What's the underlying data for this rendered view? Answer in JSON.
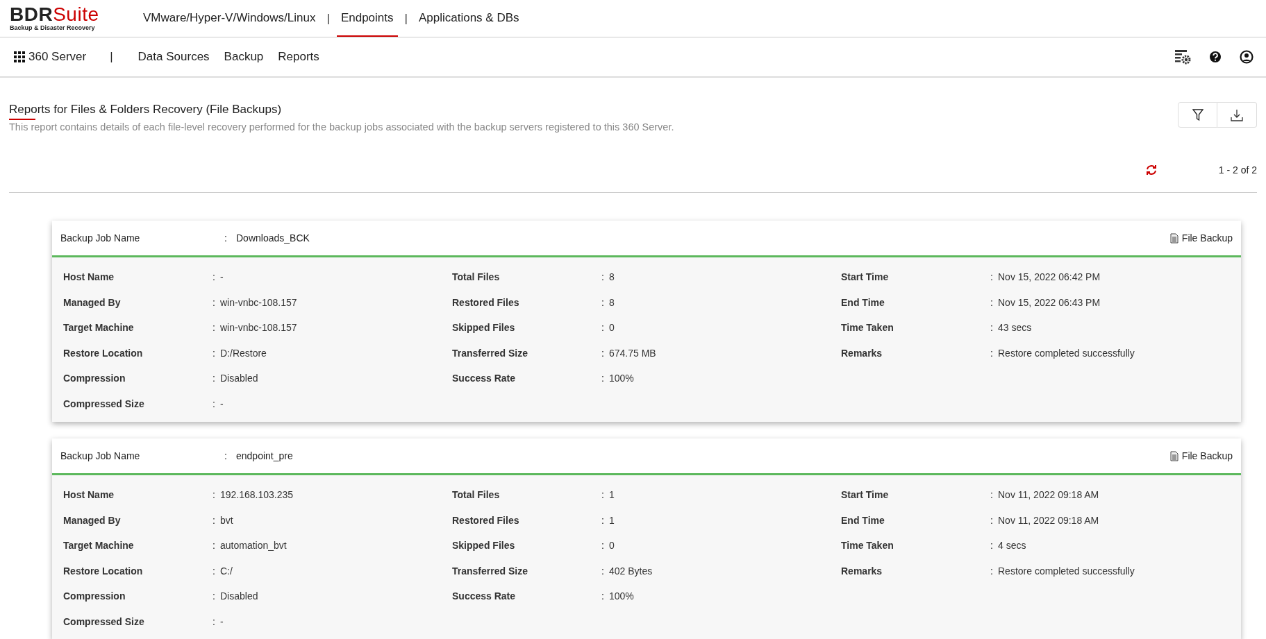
{
  "logo": {
    "brand": "BDR",
    "brand_accent": "Suite",
    "tagline": "Backup & Disaster Recovery"
  },
  "top_nav": [
    {
      "kind": "tab",
      "label": "VMware/Hyper-V/Windows/Linux",
      "selected": false
    },
    {
      "kind": "separator",
      "label": "|"
    },
    {
      "kind": "tab",
      "label": "Endpoints",
      "selected": true
    },
    {
      "kind": "separator",
      "label": "|"
    },
    {
      "kind": "tab",
      "label": "Applications & DBs",
      "selected": false
    }
  ],
  "sub_nav": {
    "server": "360 Server",
    "separator": "|",
    "items": [
      "Data Sources",
      "Backup",
      "Reports"
    ]
  },
  "page": {
    "title": "Reports for Files & Folders Recovery (File Backups)",
    "description": "This report contains details of each file-level recovery performed for the backup jobs associated with the backup servers registered to this 360 Server.",
    "pagination": "1 - 2 of 2"
  },
  "reports": [
    {
      "header": {
        "label": "Backup Job Name",
        "colon": ":",
        "value": "Downloads_BCK"
      },
      "type": "File Backup",
      "columns": [
        [
          {
            "label": "Host Name",
            "colon": ":",
            "value": "-"
          },
          {
            "label": "Managed By",
            "colon": ":",
            "value": "win-vnbc-108.157"
          },
          {
            "label": "Target Machine",
            "colon": ":",
            "value": "win-vnbc-108.157"
          },
          {
            "label": "Restore Location",
            "colon": ":",
            "value": "D:/Restore"
          },
          {
            "label": "Compression",
            "colon": ":",
            "value": "Disabled"
          },
          {
            "label": "Compressed Size",
            "colon": ":",
            "value": "-"
          }
        ],
        [
          {
            "label": "Total Files",
            "colon": ":",
            "value": "8"
          },
          {
            "label": "Restored Files",
            "colon": ":",
            "value": "8"
          },
          {
            "label": "Skipped Files",
            "colon": ":",
            "value": "0"
          },
          {
            "label": "Transferred Size",
            "colon": ":",
            "value": "674.75 MB"
          },
          {
            "label": "Success Rate",
            "colon": ":",
            "value": "100%"
          }
        ],
        [
          {
            "label": "Start Time",
            "colon": ":",
            "value": "Nov 15, 2022 06:42 PM"
          },
          {
            "label": "End Time",
            "colon": ":",
            "value": "Nov 15, 2022 06:43 PM"
          },
          {
            "label": "Time Taken",
            "colon": ":",
            "value": "43 secs"
          },
          {
            "label": "Remarks",
            "colon": ":",
            "value": "Restore completed successfully"
          }
        ]
      ]
    },
    {
      "header": {
        "label": "Backup Job Name",
        "colon": ":",
        "value": "endpoint_pre"
      },
      "type": "File Backup",
      "columns": [
        [
          {
            "label": "Host Name",
            "colon": ":",
            "value": "192.168.103.235"
          },
          {
            "label": "Managed By",
            "colon": ":",
            "value": "bvt"
          },
          {
            "label": "Target Machine",
            "colon": ":",
            "value": "automation_bvt"
          },
          {
            "label": "Restore Location",
            "colon": ":",
            "value": "C:/"
          },
          {
            "label": "Compression",
            "colon": ":",
            "value": "Disabled"
          },
          {
            "label": "Compressed Size",
            "colon": ":",
            "value": "-"
          }
        ],
        [
          {
            "label": "Total Files",
            "colon": ":",
            "value": "1"
          },
          {
            "label": "Restored Files",
            "colon": ":",
            "value": "1"
          },
          {
            "label": "Skipped Files",
            "colon": ":",
            "value": "0"
          },
          {
            "label": "Transferred Size",
            "colon": ":",
            "value": "402 Bytes"
          },
          {
            "label": "Success Rate",
            "colon": ":",
            "value": "100%"
          }
        ],
        [
          {
            "label": "Start Time",
            "colon": ":",
            "value": "Nov 11, 2022 09:18 AM"
          },
          {
            "label": "End Time",
            "colon": ":",
            "value": "Nov 11, 2022 09:18 AM"
          },
          {
            "label": "Time Taken",
            "colon": ":",
            "value": "4 secs"
          },
          {
            "label": "Remarks",
            "colon": ":",
            "value": "Restore completed successfully"
          }
        ]
      ]
    }
  ]
}
